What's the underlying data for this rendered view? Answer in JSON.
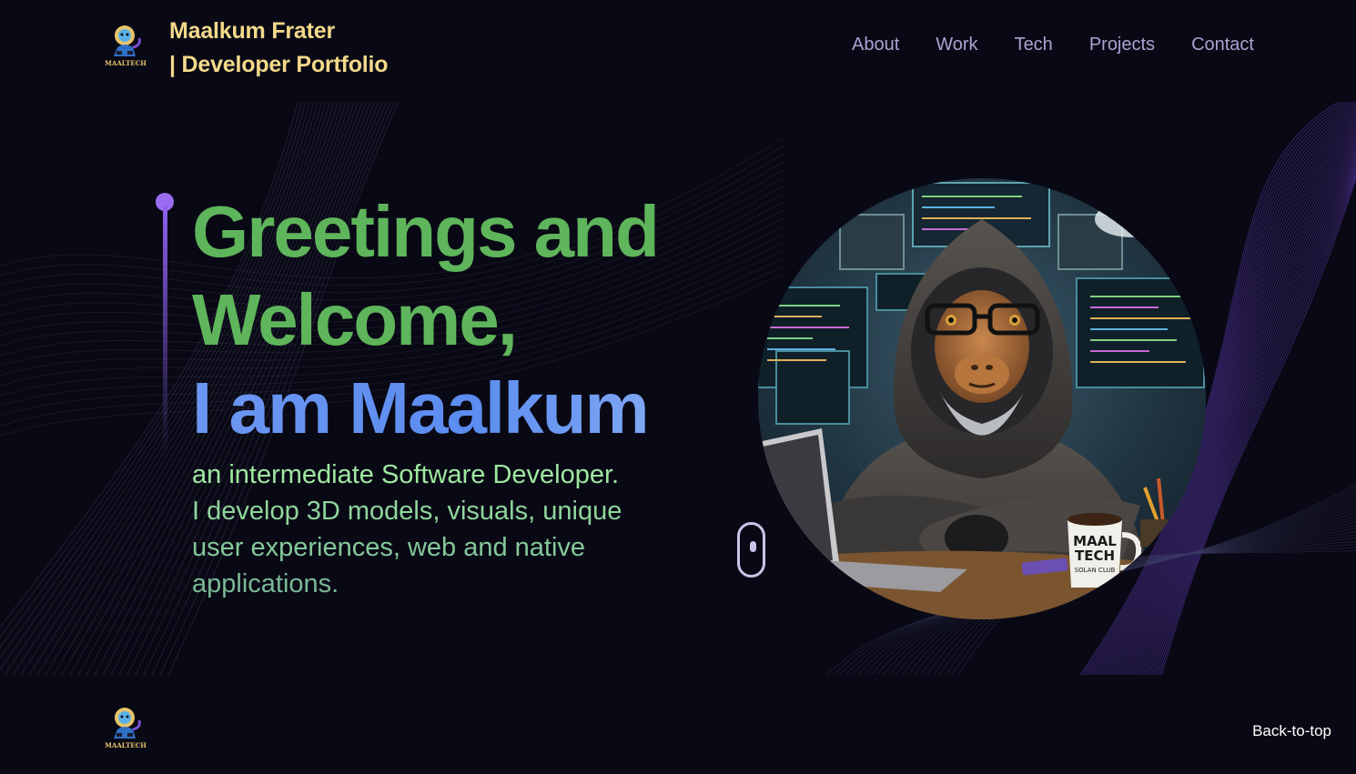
{
  "header": {
    "logo_icon": "monkey-mascot-logo",
    "logo_text": "MAALTECH",
    "brand_line1": "Maalkum Frater",
    "brand_line2": "| Developer Portfolio",
    "nav": [
      {
        "label": "About"
      },
      {
        "label": "Work"
      },
      {
        "label": "Tech"
      },
      {
        "label": "Projects"
      },
      {
        "label": "Contact"
      }
    ]
  },
  "hero": {
    "headline_line1": "Greetings and",
    "headline_line2": "Welcome,",
    "headline_line3": "I am Maalkum",
    "subtitle_line1": "an intermediate Software Developer.",
    "subtitle_line2": "I develop 3D models, visuals, unique",
    "subtitle_line3": "user experiences, web and native",
    "subtitle_line4": "applications.",
    "scroll_icon": "mouse-scroll-icon",
    "portrait": "hooded-monkey-developer-illustration",
    "mug_text_1": "MAAL",
    "mug_text_2": "TECH",
    "mug_text_3": "SOLAN CLUB"
  },
  "footer": {
    "logo_icon": "monkey-mascot-logo",
    "logo_text": "MAALTECH",
    "back_to_top": "Back-to-top"
  },
  "colors": {
    "background": "#090915",
    "brand": "#f3d98a",
    "nav": "#a9a3d1",
    "headline_green": "#5fb55b",
    "headline_blue": "#6d97f1",
    "accent_purple": "#9b6cf0"
  }
}
